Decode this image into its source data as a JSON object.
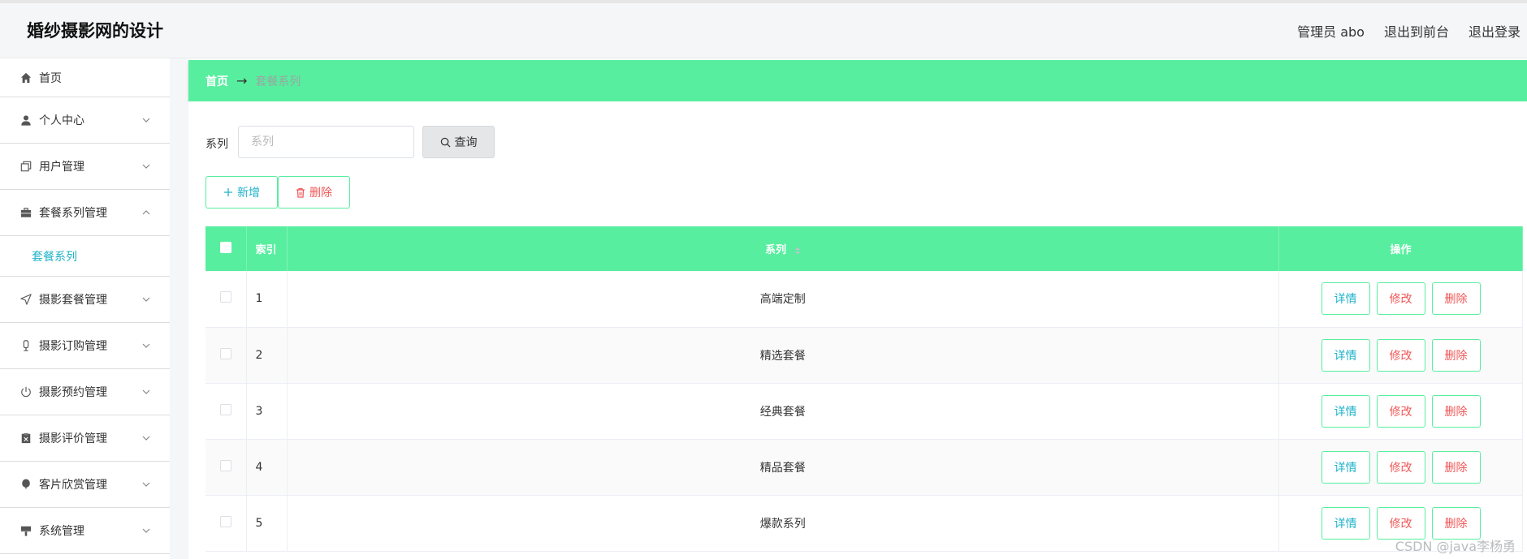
{
  "header": {
    "title": "婚纱摄影网的设计",
    "admin": "管理员 abo",
    "to_front": "退出到前台",
    "logout": "退出登录"
  },
  "sidebar": {
    "items": [
      {
        "label": "首页",
        "icon": "home-icon"
      },
      {
        "label": "个人中心",
        "icon": "user-icon"
      },
      {
        "label": "用户管理",
        "icon": "copy-icon"
      },
      {
        "label": "套餐系列管理",
        "icon": "briefcase-icon"
      },
      {
        "label": "摄影套餐管理",
        "icon": "send-icon"
      },
      {
        "label": "摄影订购管理",
        "icon": "microphone-icon"
      },
      {
        "label": "摄影预约管理",
        "icon": "power-icon"
      },
      {
        "label": "摄影评价管理",
        "icon": "clipboard-x-icon"
      },
      {
        "label": "客片欣赏管理",
        "icon": "balloon-icon"
      },
      {
        "label": "系统管理",
        "icon": "brush-icon"
      }
    ],
    "sub_active": "套餐系列"
  },
  "breadcrumb": {
    "home": "首页",
    "arrow": "→",
    "current": "套餐系列"
  },
  "search": {
    "label": "系列",
    "placeholder": "系列",
    "button": "查询"
  },
  "actions": {
    "add": "新增",
    "delete": "删除"
  },
  "table": {
    "headers": {
      "index": "索引",
      "name": "系列",
      "ops": "操作"
    },
    "rows": [
      {
        "index": "1",
        "name": "高端定制"
      },
      {
        "index": "2",
        "name": "精选套餐"
      },
      {
        "index": "3",
        "name": "经典套餐"
      },
      {
        "index": "4",
        "name": "精品套餐"
      },
      {
        "index": "5",
        "name": "爆款系列"
      }
    ],
    "op_labels": {
      "detail": "详情",
      "edit": "修改",
      "delete": "删除"
    }
  },
  "watermark": "CSDN @java李杨勇",
  "colors": {
    "accent": "#57ee9f",
    "link": "#20b2c9",
    "danger": "#f05656"
  }
}
